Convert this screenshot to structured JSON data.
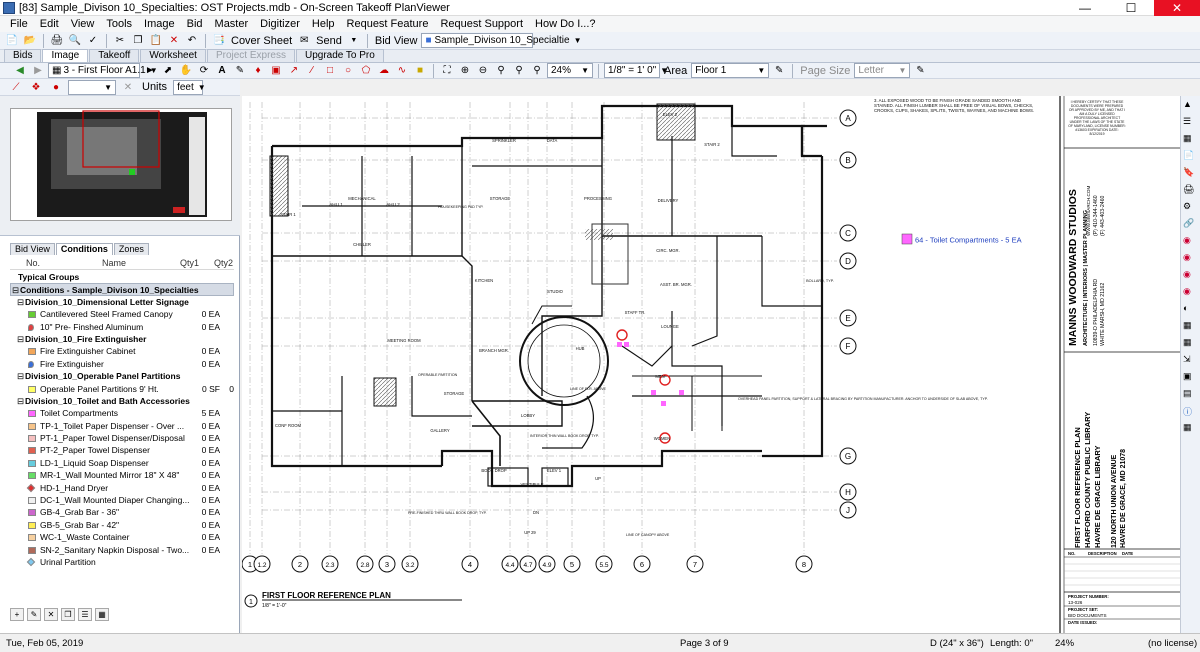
{
  "window": {
    "title": "[83] Sample_Divison 10_Specialties: OST Projects.mdb - On-Screen Takeoff PlanViewer"
  },
  "menu": [
    "File",
    "Edit",
    "View",
    "Tools",
    "Image",
    "Bid",
    "Master",
    "Digitizer",
    "Help",
    "Request Feature",
    "Request Support",
    "How Do I...?"
  ],
  "toolbar1": {
    "cover_sheet": "Cover Sheet",
    "send": "Send",
    "bid_view": "Bid View",
    "bid_combo": "Sample_Divison 10_Specialtie"
  },
  "tabs": [
    {
      "label": "Bids",
      "state": "normal"
    },
    {
      "label": "Image",
      "state": "active"
    },
    {
      "label": "Takeoff",
      "state": "normal"
    },
    {
      "label": "Worksheet",
      "state": "normal"
    },
    {
      "label": "Project Express",
      "state": "disabled"
    },
    {
      "label": "Upgrade To Pro",
      "state": "normal"
    }
  ],
  "toolbar2": {
    "page_combo": "3 - First Floor A1.1",
    "zoom": "24%",
    "scale": "1/8\" = 1' 0\"",
    "area_label": "Area",
    "area_combo": "Floor 1",
    "page_size_label": "Page Size",
    "page_size_combo": "Letter"
  },
  "toolbar3": {
    "units_label": "Units",
    "units_value": "feet"
  },
  "panel": {
    "tabs": [
      "Bid View",
      "Conditions",
      "Zones"
    ],
    "active_tab": "Conditions",
    "headers": {
      "no": "No.",
      "name": "Name",
      "qty1": "Qty1",
      "qty2": "Qty2"
    },
    "typical_groups": "Typical Groups",
    "root": "Conditions - Sample_Divison 10_Specialties",
    "groups": [
      {
        "name": "Division_10_Dimensional Letter Signage",
        "items": [
          {
            "name": "Cantilevered Steel Framed Canopy",
            "qty1": "0 EA",
            "color": "#66cc33",
            "shape": "square"
          },
          {
            "name": "10\" Pre- Finshed Aluminum",
            "qty1": "0 EA",
            "color": "#e04040",
            "shape": "pin"
          }
        ]
      },
      {
        "name": "Division_10_Fire Extinguisher",
        "items": [
          {
            "name": "Fire Extinguisher Cabinet",
            "qty1": "0 EA",
            "color": "#f2a65a",
            "shape": "square"
          },
          {
            "name": "Fire Extinguisher",
            "qty1": "0 EA",
            "color": "#3a6fd8",
            "shape": "pin"
          }
        ]
      },
      {
        "name": "Division_10_Operable Panel Partitions",
        "items": [
          {
            "name": "Operable Panel Partitions 9' Ht.",
            "qty1": "0 SF",
            "qty2": "0",
            "color": "#ffff66",
            "shape": "square"
          }
        ]
      },
      {
        "name": "Division_10_Toilet and Bath Accessories",
        "items": [
          {
            "name": "Toilet Compartments",
            "qty1": "5 EA",
            "color": "#ff66ff",
            "shape": "square"
          },
          {
            "name": "TP-1_Toilet Paper Dispenser - Over ...",
            "qty1": "0 EA",
            "color": "#f6c48a",
            "shape": "square"
          },
          {
            "name": "PT-1_Paper Towel Dispenser/Disposal",
            "qty1": "0 EA",
            "color": "#f5c0c0",
            "shape": "square"
          },
          {
            "name": "PT-2_Paper Towel Dispenser",
            "qty1": "0 EA",
            "color": "#e06050",
            "shape": "square"
          },
          {
            "name": "LD-1_Liquid Soap Dispenser",
            "qty1": "0 EA",
            "color": "#66ccdd",
            "shape": "square"
          },
          {
            "name": "MR-1_Wall Mounted Mirror 18\" X 48\"",
            "qty1": "0 EA",
            "color": "#66dd66",
            "shape": "square"
          },
          {
            "name": "HD-1_Hand Dryer",
            "qty1": "0 EA",
            "color": "#e03030",
            "shape": "diamond"
          },
          {
            "name": "DC-1_Wall Mounted Diaper Changing...",
            "qty1": "0 EA",
            "color": "#f0f0f0",
            "shape": "square"
          },
          {
            "name": "GB-4_Grab Bar - 36\"",
            "qty1": "0 EA",
            "color": "#cc66cc",
            "shape": "square"
          },
          {
            "name": "GB-5_Grab Bar - 42\"",
            "qty1": "0 EA",
            "color": "#ffee55",
            "shape": "square"
          },
          {
            "name": "WC-1_Waste Container",
            "qty1": "0 EA",
            "color": "#f6d0a0",
            "shape": "square"
          },
          {
            "name": "SN-2_Sanitary Napkin Disposal - Two...",
            "qty1": "0 EA",
            "color": "#b06a5a",
            "shape": "square"
          },
          {
            "name": "Urinal Partition",
            "qty1": "",
            "color": "#80c8ee",
            "shape": "diamond"
          }
        ]
      }
    ]
  },
  "drawing": {
    "callout": "64 - Toilet Compartments - 5 EA",
    "callout_color": "#ff66ff",
    "title": "FIRST FLOOR REFERENCE PLAN",
    "title_scale": "1/8\" = 1'-0\"",
    "title_number": "1",
    "note_top": "3. ALL EXPOSED WOOD TO BE FINISH GRADE SANDED SMOOTH AND STAINED. ALL FINISH LUMBER SHALL BE FREE OF VISUAL BOWS, CHECKS, CROOKS, CUPS, SHAKES, SPLITS, TWISTS, WAYNES, AND MACHINE BOWS.",
    "grid_rows": [
      "A",
      "B",
      "C",
      "D",
      "E",
      "F",
      "G",
      "H",
      "J"
    ],
    "grid_cols": [
      "1",
      "1.2",
      "2",
      "2.3",
      "2.8",
      "3",
      "3.2",
      "4",
      "4.4",
      "4.7",
      "4.9",
      "5",
      "5.5",
      "6",
      "7",
      "8"
    ],
    "rooms": [
      "SPRINKLER",
      "DATA",
      "MECHANICAL",
      "AHU 1",
      "AHU 2",
      "CHILLER",
      "STORAGE",
      "PROCESSING",
      "DELIVERY",
      "CIRC. MGR.",
      "ASST. BR. MGR.",
      "STAFF TR.",
      "LOUNGE",
      "KITCHEN",
      "STUDIO",
      "MEETING ROOM",
      "BRANCH MGR.",
      "HUB",
      "MEN",
      "WOMEN",
      "STORAGE",
      "GALLERY",
      "LOBBY",
      "CONF ROOM",
      "BOOK DROP",
      "VESTIBULE",
      "ELEV 1",
      "STAIR 1",
      "STAIR 2",
      "ELEV 2",
      "HOUSEKEEPING PAD TYP.",
      "OPERABLE PARTITION",
      "LINE OF FLR. ABOVE",
      "INTERIOR THIN WALL BOOK DROP, TYP.",
      "PRE-FINISHED THRU WALL BOOK DROP, TYP.",
      "LINE OF CANOPY ABOVE",
      "OVERHEAD PANEL PARTITION, SUPPORT & LATERAL BRACING BY PARTITION MANUFACTURER. ANCHOR TO UNDERSIDE OF SLAB ABOVE, TYP.",
      "BOLLARD, TYP.",
      "DN",
      "UP 29",
      "UP"
    ],
    "firm": "MANNS WOODWARD STUDIOS",
    "firm_sub": "ARCHITECTURE | INTERIORS | MASTER PLANNING",
    "firm_addr1": "10839-D PHILADELPHIA RD",
    "firm_addr2": "WHITE MARSH, MD 21162",
    "firm_phone": "(P) 410-344-1460",
    "firm_fax": "(F) 443-403-2460",
    "firm_web": "WWW.MWSARCH.COM",
    "cert": "I HEREBY CERTIFY THAT THESE DOCUMENTS WERE PREPARED OR APPROVED BY ME, AND THAT I AM A DULY LICENSED PROFESSIONAL ARCHITECT UNDER THE LAWS OF THE STATE OF MARYLAND, LICENSE NUMBER: #13603 EXPIRATION DATE: 8/12/2019",
    "sheet_title": "FIRST FLOOR REFERENCE PLAN",
    "project1": "HARFORD COUNTY PUBLIC LIBRARY",
    "project2": "HAVRE DE GRACE LIBRARY",
    "proj_addr1": "120 NORTH UNION AVENUE",
    "proj_addr2": "HAVRE DE GRACE, MD 21078",
    "rev_no": "NO.",
    "rev_desc": "DESCRIPTION",
    "rev_date": "DATE",
    "project_number_label": "PROJECT NUMBER:",
    "project_number": "13-026",
    "project_set_label": "PROJECT SET:",
    "project_set": "BID DOCUMENTS",
    "date_issued_label": "DATE ISSUED:"
  },
  "status": {
    "date": "Tue, Feb 05, 2019",
    "page": "Page 3 of 9",
    "size": "D (24\" x 36\")",
    "length": "Length: 0\"",
    "zoom": "24%",
    "license": "(no license)"
  }
}
